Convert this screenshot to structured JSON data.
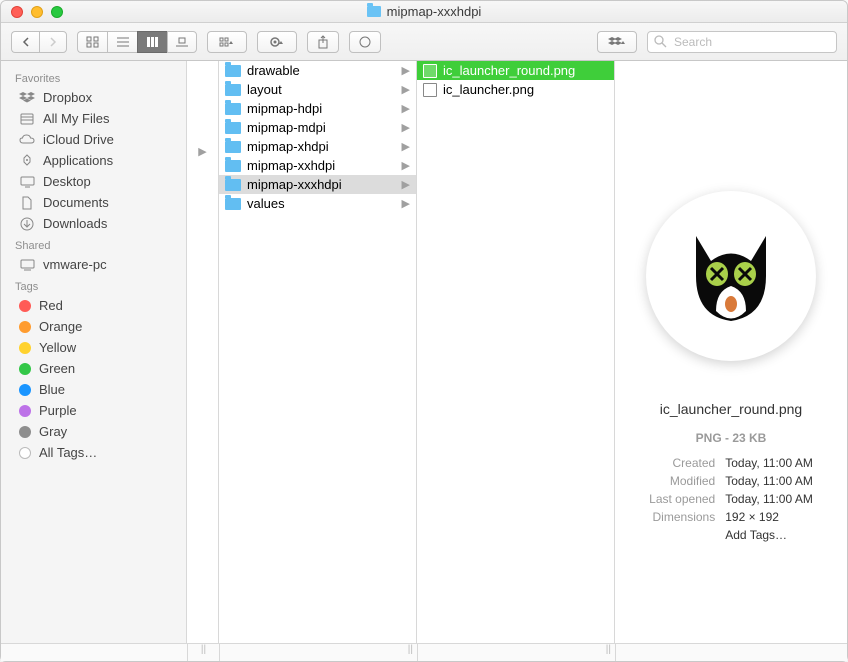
{
  "window": {
    "title": "mipmap-xxxhdpi"
  },
  "search": {
    "placeholder": "Search"
  },
  "sidebar": {
    "sections": {
      "favorites": {
        "header": "Favorites",
        "items": [
          "Dropbox",
          "All My Files",
          "iCloud Drive",
          "Applications",
          "Desktop",
          "Documents",
          "Downloads"
        ]
      },
      "shared": {
        "header": "Shared",
        "items": [
          "vmware-pc"
        ]
      },
      "tags": {
        "header": "Tags",
        "items": [
          {
            "label": "Red",
            "color": "#ff5b56"
          },
          {
            "label": "Orange",
            "color": "#ff9c2f"
          },
          {
            "label": "Yellow",
            "color": "#ffd22e"
          },
          {
            "label": "Green",
            "color": "#33c748"
          },
          {
            "label": "Blue",
            "color": "#1a95ff"
          },
          {
            "label": "Purple",
            "color": "#bd72e8"
          },
          {
            "label": "Gray",
            "color": "#8e8e8e"
          }
        ],
        "all": "All Tags…"
      }
    }
  },
  "col2": {
    "items": [
      "drawable",
      "layout",
      "mipmap-hdpi",
      "mipmap-mdpi",
      "mipmap-xhdpi",
      "mipmap-xxhdpi",
      "mipmap-xxxhdpi",
      "values"
    ],
    "selected_index": 6
  },
  "col3": {
    "items": [
      "ic_launcher_round.png",
      "ic_launcher.png"
    ],
    "selected_index": 0
  },
  "preview": {
    "filename": "ic_launcher_round.png",
    "type_size": "PNG - 23 KB",
    "fields": {
      "created_k": "Created",
      "created_v": "Today, 11:00 AM",
      "modified_k": "Modified",
      "modified_v": "Today, 11:00 AM",
      "opened_k": "Last opened",
      "opened_v": "Today, 11:00 AM",
      "dim_k": "Dimensions",
      "dim_v": "192 × 192"
    },
    "add_tags": "Add Tags…"
  }
}
